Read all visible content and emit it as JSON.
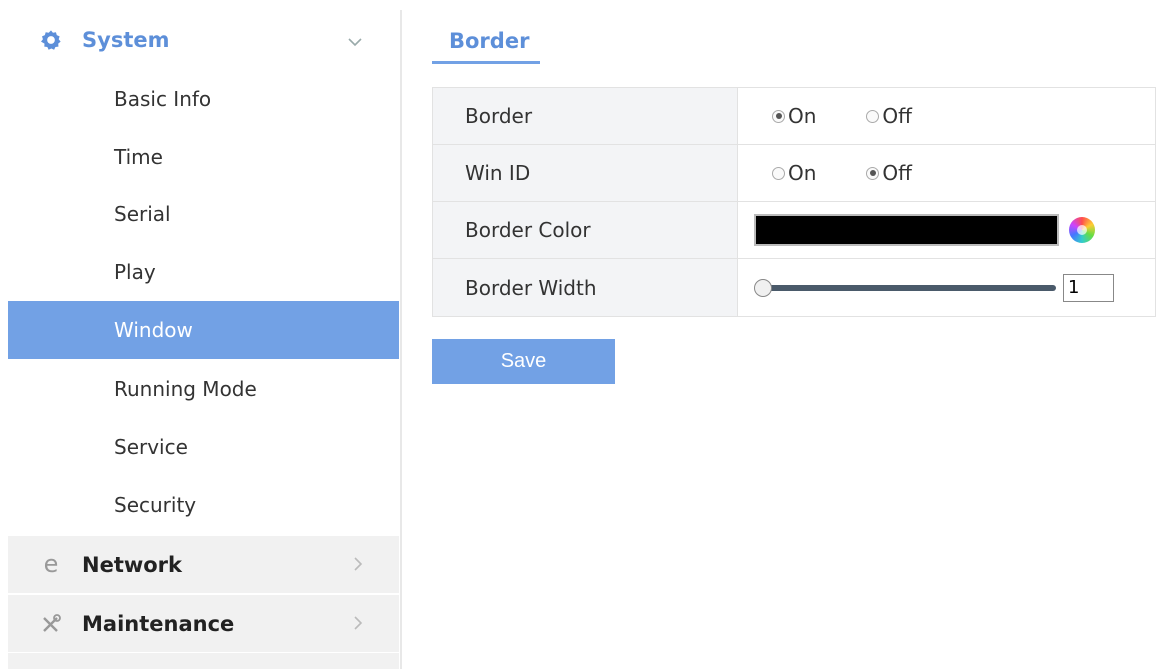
{
  "sidebar": {
    "system": {
      "label": "System",
      "icon": "gear-icon"
    },
    "items": [
      {
        "label": "Basic Info"
      },
      {
        "label": "Time"
      },
      {
        "label": "Serial"
      },
      {
        "label": "Play"
      },
      {
        "label": "Window"
      },
      {
        "label": "Running Mode"
      },
      {
        "label": "Service"
      },
      {
        "label": "Security"
      }
    ],
    "active_item": "Window",
    "network": {
      "label": "Network",
      "icon": "network-icon"
    },
    "maintenance": {
      "label": "Maintenance",
      "icon": "tools-icon"
    }
  },
  "main": {
    "tab": {
      "label": "Border"
    },
    "form": {
      "border": {
        "label": "Border",
        "on": "On",
        "off": "Off",
        "selected": "On"
      },
      "win_id": {
        "label": "Win ID",
        "on": "On",
        "off": "Off",
        "selected": "Off"
      },
      "border_color": {
        "label": "Border Color",
        "value": "#000000"
      },
      "border_width": {
        "label": "Border Width",
        "value": "1"
      }
    },
    "save_label": "Save"
  },
  "colors": {
    "accent": "#72a1e5",
    "accent_text": "#5d8fd9",
    "sidebar_group_bg": "#f1f1f1",
    "label_bg": "#f3f4f6"
  }
}
